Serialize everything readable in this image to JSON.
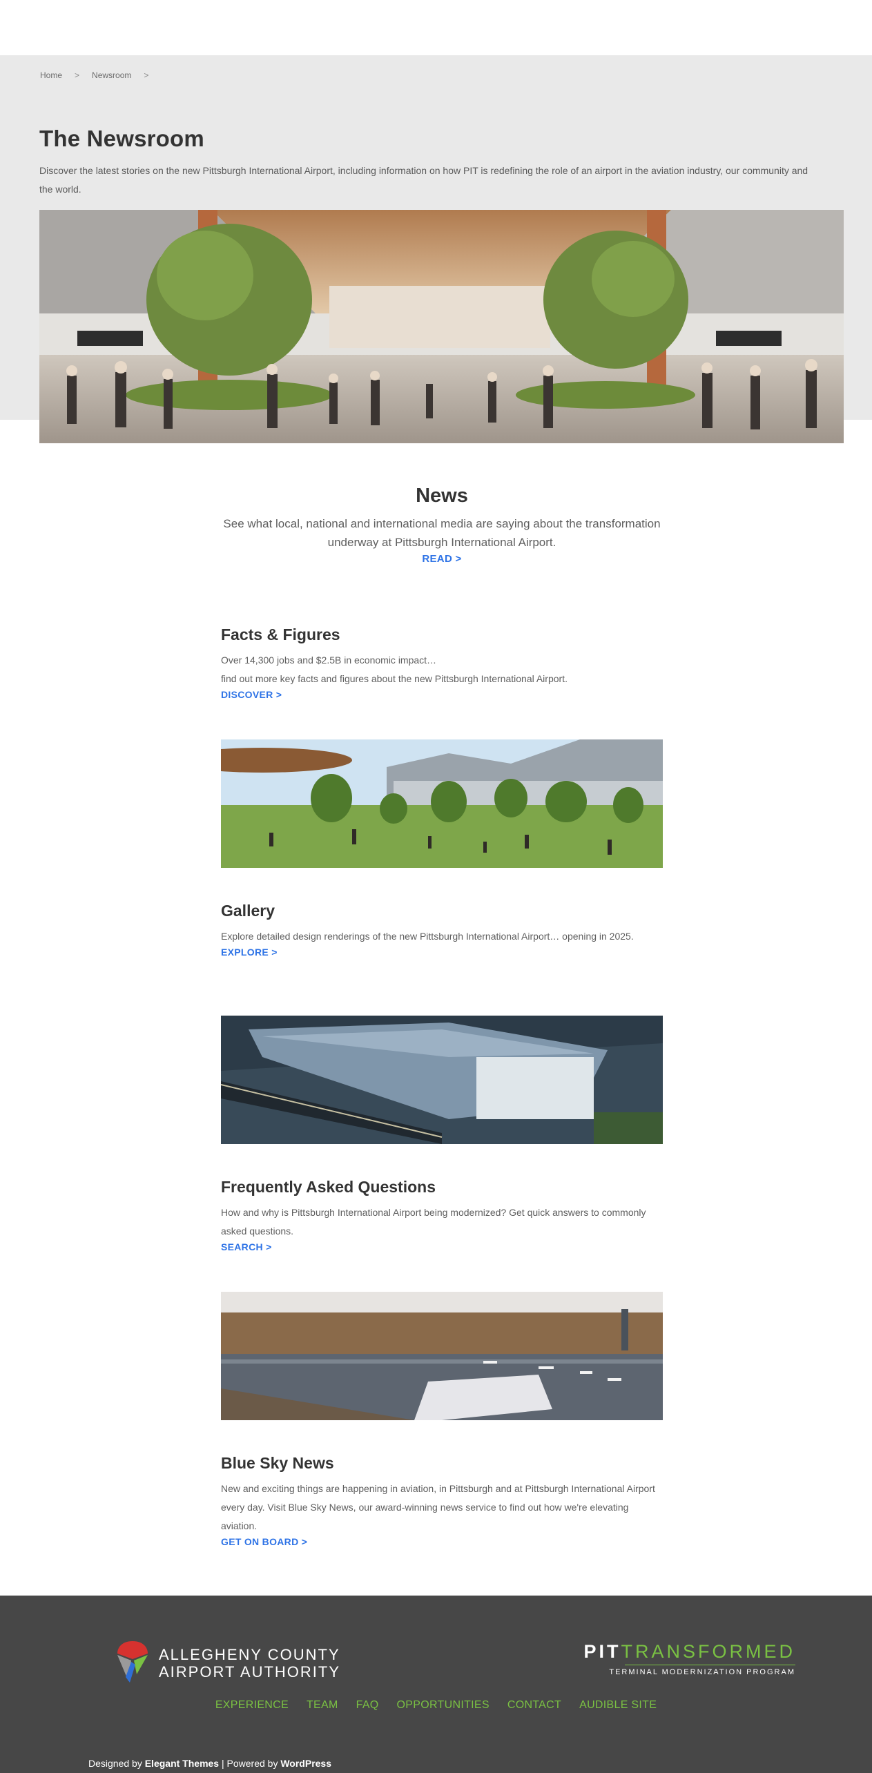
{
  "breadcrumb": {
    "home": "Home",
    "sep1": ">",
    "newsroom": "Newsroom",
    "sep2": ">"
  },
  "page": {
    "title": "The Newsroom",
    "intro": "Discover the latest stories on the new Pittsburgh International Airport, including information on how PIT is redefining the role of an airport in the aviation industry, our community and the world."
  },
  "news": {
    "title": "News",
    "description": "See what local, national and international media are saying about the transformation underway at Pittsburgh International Airport.",
    "cta": "READ >"
  },
  "sections": {
    "facts": {
      "title": "Facts & Figures",
      "line1": "Over 14,300 jobs and $2.5B in economic impact…",
      "line2": "find out more key facts and figures about the new Pittsburgh International Airport.",
      "cta": "DISCOVER >"
    },
    "gallery": {
      "title": "Gallery",
      "text": "Explore detailed design renderings of the new Pittsburgh International Airport… opening in 2025.",
      "cta": "EXPLORE >"
    },
    "faq": {
      "title": "Frequently Asked Questions",
      "text": "How and why is Pittsburgh International Airport being modernized? Get quick answers to commonly asked questions.",
      "cta": "SEARCH >"
    },
    "bluesky": {
      "title": "Blue Sky News",
      "text": "New and exciting things are happening in aviation, in Pittsburgh and at Pittsburgh International Airport every day. Visit Blue Sky News, our award-winning news service to find out how we're elevating aviation.",
      "cta": "GET ON BOARD >"
    }
  },
  "footer": {
    "aca_line1": "ALLEGHENY COUNTY",
    "aca_line2": "AIRPORT AUTHORITY",
    "pit": "PIT",
    "transformed": "TRANSFORMED",
    "program": "TERMINAL MODERNIZATION PROGRAM",
    "nav": [
      "EXPERIENCE",
      "TEAM",
      "FAQ",
      "OPPORTUNITIES",
      "CONTACT",
      "AUDIBLE SITE"
    ],
    "credits": {
      "designed_by": "Designed by",
      "elegant": "Elegant Themes",
      "divider": "| Powered by",
      "wordpress": "WordPress"
    },
    "accent": "#7ac143",
    "background": "#474747"
  },
  "colors": {
    "link": "#2e73e6",
    "hero_band": "#e9e9e9"
  }
}
